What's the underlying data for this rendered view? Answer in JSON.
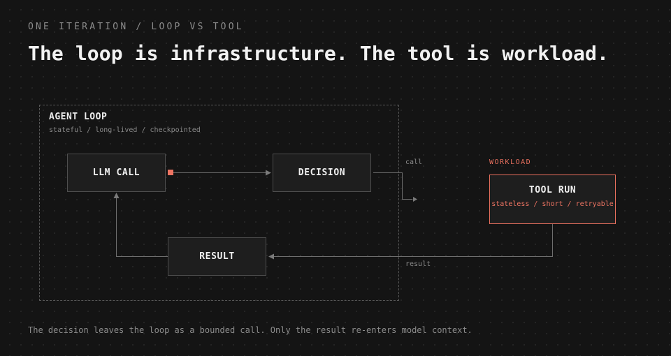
{
  "header": {
    "eyebrow": "ONE ITERATION / LOOP VS TOOL",
    "headline": "The loop is infrastructure. The tool is workload."
  },
  "loop": {
    "title": "AGENT LOOP",
    "subtitle": "stateful / long-lived / checkpointed"
  },
  "nodes": {
    "llm_call": "LLM CALL",
    "decision": "DECISION",
    "result": "RESULT"
  },
  "edges": {
    "call_label": "call",
    "result_label": "result"
  },
  "workload": {
    "label": "WORKLOAD",
    "tool_title": "TOOL RUN",
    "tool_subtitle": "stateless / short / retryable"
  },
  "caption": "The decision leaves the loop as a bounded call. Only the result re-enters model context.",
  "colors": {
    "background": "#141414",
    "accent": "#ee7462",
    "node_fill": "#1e1e1e",
    "node_border": "#4e4e4e",
    "muted_text": "#8c8c8c",
    "wire": "#6e6e6e"
  },
  "icons": {
    "output_port": "square-port-icon",
    "edge_arrow": "arrowhead-icon"
  }
}
